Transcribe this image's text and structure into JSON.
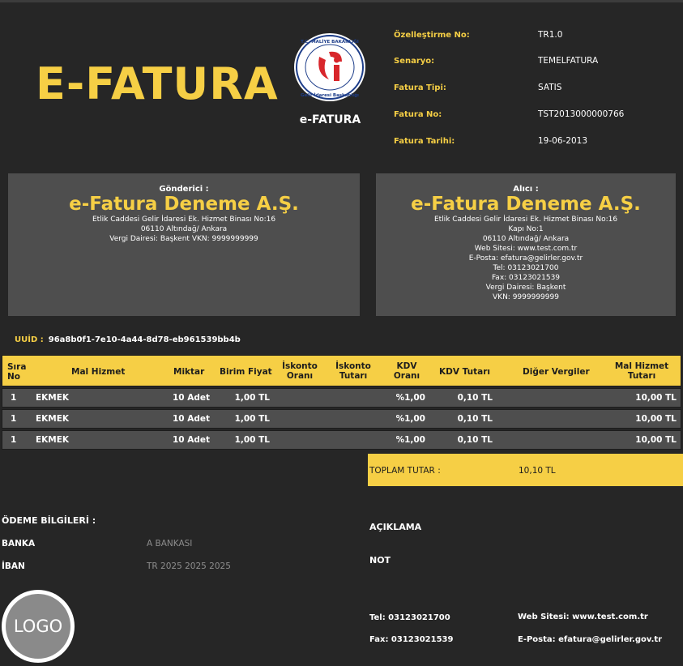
{
  "header": {
    "title": "E-FATURA",
    "seal_caption": "e-FATURA",
    "seal_text_top": "T.C. MALİYE BAKANLIĞI",
    "seal_text_bottom": "Gelir İdaresi Başkanlığı",
    "meta": [
      {
        "label": "Özelleştirme No:",
        "value": "TR1.0"
      },
      {
        "label": "Senaryo:",
        "value": "TEMELFATURA"
      },
      {
        "label": "Fatura Tipi:",
        "value": "SATIS"
      },
      {
        "label": "Fatura No:",
        "value": "TST2013000000766"
      },
      {
        "label": "Fatura Tarihi:",
        "value": "19-06-2013"
      }
    ]
  },
  "sender": {
    "caption": "Gönderici :",
    "name": "e-Fatura Deneme A.Ş.",
    "lines": [
      "Etlik Caddesi Gelir İdaresi Ek. Hizmet Binası No:16",
      "06110 Altındağ/ Ankara",
      "Vergi Dairesi: Başkent  VKN: 9999999999"
    ]
  },
  "receiver": {
    "caption": "Alıcı :",
    "name": "e-Fatura Deneme A.Ş.",
    "lines": [
      "Etlik Caddesi Gelir İdaresi Ek. Hizmet Binası No:16",
      "Kapı No:1",
      "06110 Altındağ/ Ankara",
      "Web Sitesi: www.test.com.tr",
      "E-Posta: efatura@gelirler.gov.tr",
      "Tel: 03123021700",
      "Fax: 03123021539",
      "Vergi Dairesi: Başkent",
      "VKN: 9999999999"
    ]
  },
  "uuid": {
    "label": "UUİD :",
    "value": "96a8b0f1-7e10-4a44-8d78-eb961539bb4b"
  },
  "table": {
    "headers": {
      "sira": "Sıra No",
      "mal_hizmet": "Mal Hizmet",
      "miktar": "Miktar",
      "birim_fiyat": "Birim Fiyat",
      "iskonto_orani": "İskonto Oranı",
      "iskonto_tutari": "İskonto Tutarı",
      "kdv_orani": "KDV Oranı",
      "kdv_tutari": "KDV Tutarı",
      "diger_vergiler": "Diğer Vergiler",
      "mal_hizmet_tutari": "Mal Hizmet Tutarı"
    },
    "rows": [
      {
        "sira": "1",
        "mal_hizmet": "EKMEK",
        "miktar": "10 Adet",
        "birim_fiyat": "1,00 TL",
        "iskonto_orani": "",
        "iskonto_tutari": "",
        "kdv_orani": "%1,00",
        "kdv_tutari": "0,10 TL",
        "diger_vergiler": "",
        "mal_hizmet_tutari": "10,00 TL"
      },
      {
        "sira": "1",
        "mal_hizmet": "EKMEK",
        "miktar": "10 Adet",
        "birim_fiyat": "1,00 TL",
        "iskonto_orani": "",
        "iskonto_tutari": "",
        "kdv_orani": "%1,00",
        "kdv_tutari": "0,10 TL",
        "diger_vergiler": "",
        "mal_hizmet_tutari": "10,00 TL"
      },
      {
        "sira": "1",
        "mal_hizmet": "EKMEK",
        "miktar": "10 Adet",
        "birim_fiyat": "1,00 TL",
        "iskonto_orani": "",
        "iskonto_tutari": "",
        "kdv_orani": "%1,00",
        "kdv_tutari": "0,10 TL",
        "diger_vergiler": "",
        "mal_hizmet_tutari": "10,00 TL"
      }
    ]
  },
  "total": {
    "label": "TOPLAM TUTAR :",
    "value": "10,10 TL"
  },
  "payment": {
    "title": "ÖDEME BİLGİLERİ :",
    "bank_label": "BANKA",
    "bank_value": "A BANKASI",
    "iban_label": "İBAN",
    "iban_value": "TR 2025 2025 2025"
  },
  "notes": {
    "aciklama": "AÇIKLAMA",
    "not": "NOT"
  },
  "contact": {
    "tel": "Tel: 03123021700",
    "fax": "Fax: 03123021539",
    "web": "Web Sitesi: www.test.com.tr",
    "email": "E-Posta: efatura@gelirler.gov.tr"
  },
  "logo": {
    "text": "LOGO"
  },
  "colors": {
    "accent": "#f6cf45",
    "background": "#262626",
    "panel": "#4e4e4e"
  }
}
